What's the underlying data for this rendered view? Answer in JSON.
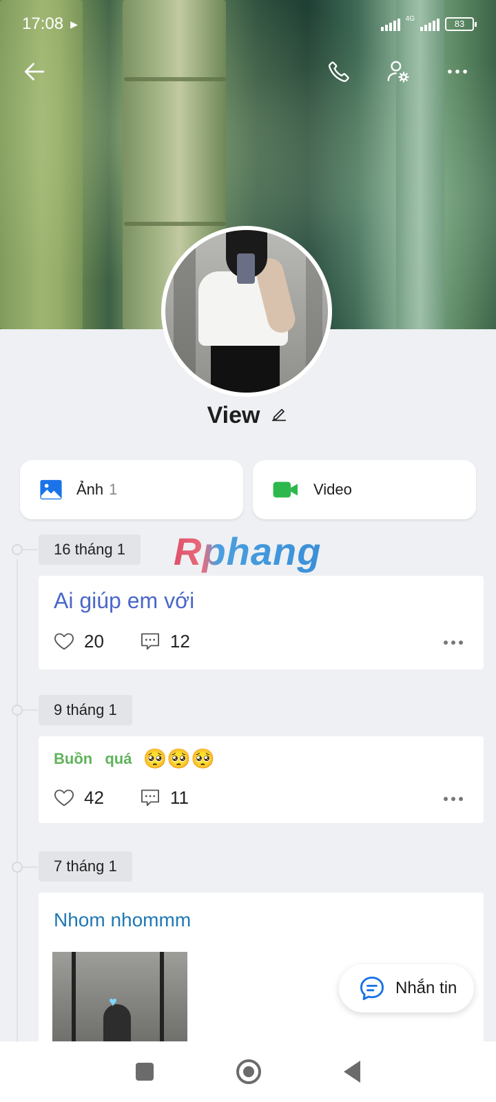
{
  "status_bar": {
    "time": "17:08",
    "network": "4G",
    "battery": "83"
  },
  "header": {
    "back_icon": "arrow-left-icon",
    "call_icon": "phone-icon",
    "settings_icon": "user-gear-icon",
    "more_icon": "more-horizontal-icon"
  },
  "profile": {
    "name": "View"
  },
  "media": {
    "photos_label": "Ảnh",
    "photos_count": "1",
    "video_label": "Video",
    "photos_color": "#1a73e8",
    "video_color": "#2db84d"
  },
  "watermark": "Rphang",
  "posts": [
    {
      "date": "16 tháng 1",
      "text": "Ai giúp em với",
      "likes": "20",
      "comments": "12"
    },
    {
      "date": "9 tháng 1",
      "text": "Buồn quá",
      "emoji": "🥺🥺🥺",
      "likes": "42",
      "comments": "11"
    },
    {
      "date": "7 tháng 1",
      "text": "Nhom nhommm"
    }
  ],
  "fab": {
    "label": "Nhắn tin"
  },
  "colors": {
    "accent_blue": "#1a73e8",
    "text_blue": "#4a67c9",
    "text_green": "#5fb35a",
    "background": "#eef0f3"
  }
}
